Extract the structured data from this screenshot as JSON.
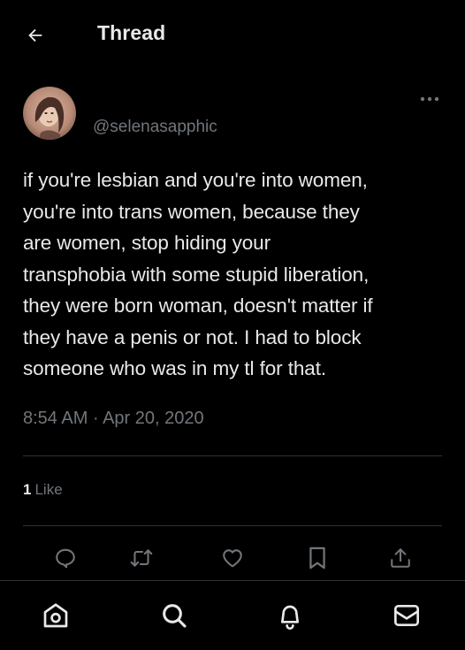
{
  "header": {
    "title": "Thread",
    "back_icon": "arrow-left-icon"
  },
  "tweet": {
    "handle": "@selenasapphic",
    "text": "if you're lesbian and you're into women,\nyou're into trans women, because they\nare women, stop hiding your\ntransphobia with some stupid liberation,\nthey were born woman, doesn't matter if\nthey have a penis or not. I had to block\nsomeone who was in my tl for that.",
    "time": "8:54 AM",
    "separator": " · ",
    "date": "Apr 20, 2020",
    "like_count": "1",
    "like_label": "Like"
  },
  "actions": [
    "reply-icon",
    "retweet-icon",
    "like-icon",
    "bookmark-icon",
    "share-icon"
  ],
  "bottom_nav": [
    "home-icon",
    "search-icon",
    "notifications-icon",
    "messages-icon"
  ],
  "colors": {
    "background": "#000000",
    "text": "#e7e9ea",
    "secondary_text": "#71767b",
    "divider": "#2f3336"
  }
}
